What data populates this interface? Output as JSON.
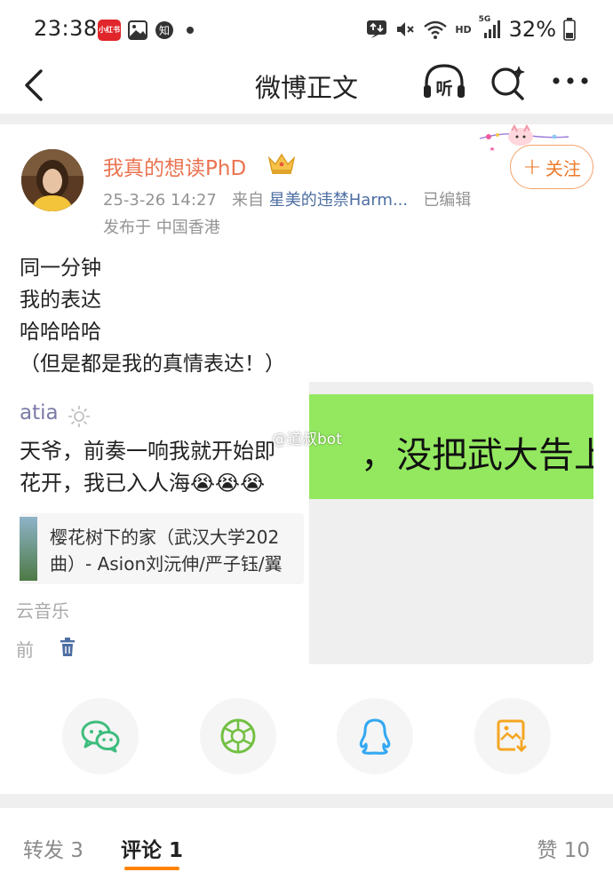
{
  "status_bar": {
    "time": "23:38",
    "app_badge": "小红书",
    "network_hd": "HD",
    "network_gen": "5G",
    "battery": "32%"
  },
  "nav": {
    "title": "微博正文",
    "listen_label": "听"
  },
  "post": {
    "user_name": "我真的想读PhD",
    "date": "25-3-26 14:27",
    "from_label": "来自",
    "source": "星美的违禁Harm...",
    "edited": "已编辑",
    "location": "发布于 中国香港",
    "follow_label": "关注",
    "text_lines": [
      "同一分钟",
      "我的表达",
      "哈哈哈哈",
      "（但是都是我的真情表达！）"
    ]
  },
  "embedded_shot": {
    "username": "atia",
    "line1": "天爷，前奏一响我就开始即",
    "line2": "花开，我已入人海😭😭😭",
    "card_line1": "樱花树下的家（武汉大学202",
    "card_line2": "曲）- Asion刘沅伸/严子钰/翼",
    "music_label": "云音乐",
    "time_label": "前",
    "green_text": "，没把武大告上",
    "watermark": "@道叔bot"
  },
  "share": {
    "items": [
      "wechat-icon",
      "moments-icon",
      "qq-icon",
      "save-image-icon"
    ],
    "colors": {
      "wechat": "#3dbd7d",
      "moments": "#72c043",
      "qq": "#33a8f2",
      "save": "#f5a623"
    }
  },
  "tabs": {
    "repost": "转发 3",
    "comment": "评论 1",
    "like": "赞 10"
  },
  "colors": {
    "accent": "#ff8200",
    "username": "#eb7350",
    "link": "#4d6ea3"
  }
}
